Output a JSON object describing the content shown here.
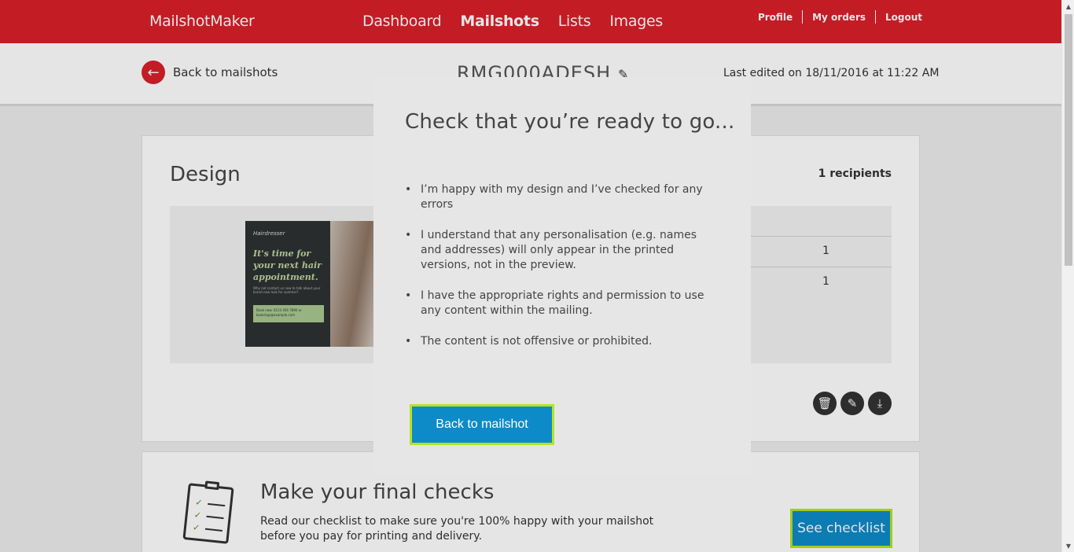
{
  "brand": "MailshotMaker",
  "nav": {
    "main": [
      {
        "label": "Dashboard",
        "active": false
      },
      {
        "label": "Mailshots",
        "active": true
      },
      {
        "label": "Lists",
        "active": false
      },
      {
        "label": "Images",
        "active": false
      }
    ],
    "util": [
      "Profile",
      "My orders",
      "Logout"
    ]
  },
  "subheader": {
    "back_label": "Back to mailshots",
    "mailshot_name": "RMG000ADESH",
    "last_edited": "Last edited on 18/11/2016 at 11:22 AM"
  },
  "design": {
    "title": "Design",
    "recipients": "1 recipients",
    "row_values": [
      "1",
      "1"
    ],
    "thumbnail": {
      "brand": "Hairdresser",
      "headline": "It's time for your next hair appointment.",
      "body": "Why not contact us now to talk about your brand new look for summer?",
      "box": "Book now: 0123 456 7890 or bookings@example.com"
    },
    "actions": [
      {
        "icon": "trash-icon",
        "glyph": "🗑"
      },
      {
        "icon": "pencil-icon",
        "glyph": "✎"
      },
      {
        "icon": "download-icon",
        "glyph": "⤓"
      }
    ]
  },
  "checks": {
    "title": "Make your final checks",
    "text": "Read our checklist to make sure you're 100% happy with your mailshot before you pay for printing and delivery.",
    "button": "See checklist"
  },
  "modal": {
    "title": "Check that you’re ready to go...",
    "items": [
      "I’m happy with my design and I’ve checked for any errors",
      "I understand that any personalisation (e.g. names and addresses) will only appear in the printed versions, not in the preview.",
      "I have the appropriate rights and permission to use any content within the mailing.",
      "The content is not offensive or prohibited."
    ],
    "button": "Back to mailshot"
  },
  "colors": {
    "brand_red": "#da202a",
    "button_blue": "#0d8bc9",
    "focus_outline": "#b8e31d"
  }
}
